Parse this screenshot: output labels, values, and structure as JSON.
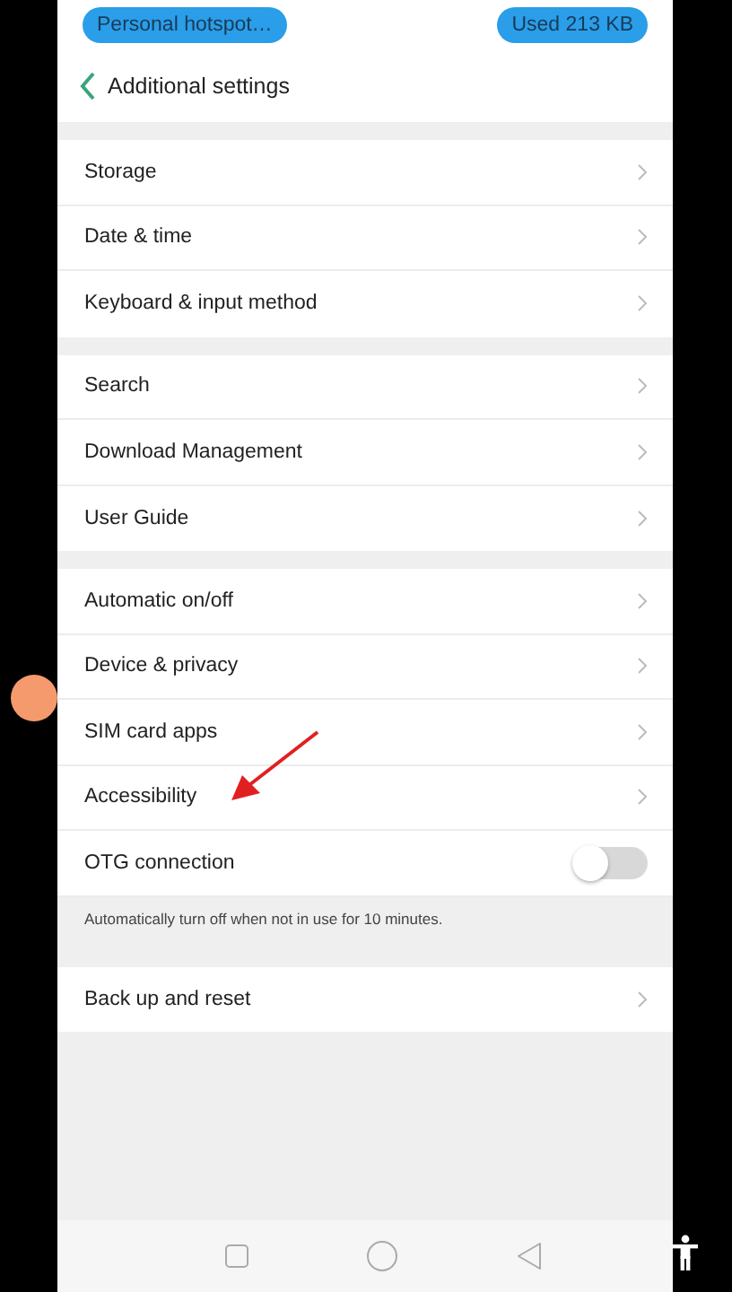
{
  "status_bar": {
    "left_pill": "Personal hotspot…",
    "right_pill": "Used  213 KB"
  },
  "header": {
    "title": "Additional settings"
  },
  "groups": [
    {
      "items": [
        {
          "label": "Storage",
          "kind": "link"
        },
        {
          "label": "Date & time",
          "kind": "link"
        },
        {
          "label": "Keyboard & input method",
          "kind": "link"
        }
      ]
    },
    {
      "items": [
        {
          "label": "Search",
          "kind": "link"
        },
        {
          "label": "Download Management",
          "kind": "link"
        },
        {
          "label": "User Guide",
          "kind": "link"
        }
      ]
    },
    {
      "items": [
        {
          "label": "Automatic on/off",
          "kind": "link"
        },
        {
          "label": "Device & privacy",
          "kind": "link"
        },
        {
          "label": "SIM card apps",
          "kind": "link"
        },
        {
          "label": "Accessibility",
          "kind": "link"
        },
        {
          "label": "OTG connection",
          "kind": "toggle",
          "on": false
        }
      ],
      "note": "Automatically turn off when not in use for 10 minutes."
    },
    {
      "items": [
        {
          "label": "Back up and reset",
          "kind": "link"
        }
      ]
    }
  ]
}
